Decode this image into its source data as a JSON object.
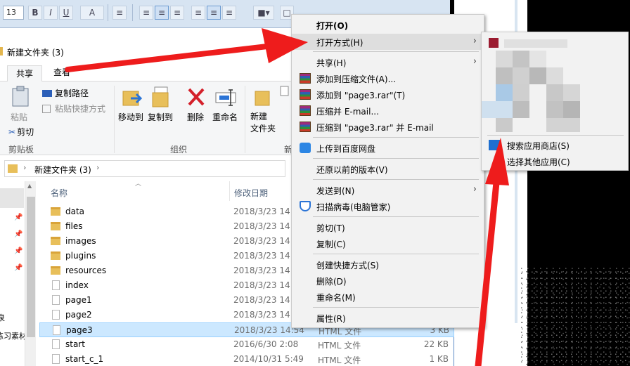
{
  "editor_toolbar": {
    "size_value": "13",
    "bold": "B",
    "italic": "I",
    "underline": "U",
    "font_color": "A"
  },
  "window": {
    "title": "新建文件夹 (3)"
  },
  "ribbon": {
    "tabs": [
      {
        "label": "共享"
      },
      {
        "label": "查看"
      }
    ],
    "clipboard": {
      "paste": "粘贴",
      "copy_path": "复制路径",
      "paste_shortcut": "粘贴快捷方式",
      "cut": "剪切",
      "group": "剪贴板"
    },
    "organize": {
      "move_to": "移动到",
      "copy_to": "复制到",
      "delete": "删除",
      "rename": "重命名",
      "group": "组织"
    },
    "new": {
      "new_folder": "新建\n文件夹",
      "group": "新"
    }
  },
  "address": {
    "path": "新建文件夹 (3)"
  },
  "nav": {
    "items": [
      "泉",
      "练习素材"
    ]
  },
  "columns": {
    "name": "名称",
    "date": "修改日期"
  },
  "files": [
    {
      "name": "data",
      "date": "2018/3/23 14:",
      "type": "",
      "size": "",
      "kind": "folder"
    },
    {
      "name": "files",
      "date": "2018/3/23 14:",
      "type": "",
      "size": "",
      "kind": "folder"
    },
    {
      "name": "images",
      "date": "2018/3/23 14:",
      "type": "",
      "size": "",
      "kind": "folder"
    },
    {
      "name": "plugins",
      "date": "2018/3/23 14:",
      "type": "",
      "size": "",
      "kind": "folder"
    },
    {
      "name": "resources",
      "date": "2018/3/23 14:",
      "type": "",
      "size": "",
      "kind": "folder"
    },
    {
      "name": "index",
      "date": "2018/3/23 14:",
      "type": "",
      "size": "",
      "kind": "file"
    },
    {
      "name": "page1",
      "date": "2018/3/23 14:",
      "type": "",
      "size": "",
      "kind": "file"
    },
    {
      "name": "page2",
      "date": "2018/3/23 14:",
      "type": "",
      "size": "",
      "kind": "file"
    },
    {
      "name": "page3",
      "date": "2018/3/23 14:54",
      "type": "HTML 文件",
      "size": "3 KB",
      "kind": "file"
    },
    {
      "name": "start",
      "date": "2016/6/30 2:08",
      "type": "HTML 文件",
      "size": "22 KB",
      "kind": "file"
    },
    {
      "name": "start_c_1",
      "date": "2014/10/31 5:49",
      "type": "HTML 文件",
      "size": "1 KB",
      "kind": "file"
    }
  ],
  "context_menu": {
    "open": "打开(O)",
    "open_with": "打开方式(H)",
    "share": "共享(H)",
    "add_archive": "添加到压缩文件(A)...",
    "add_rar": "添加到 \"page3.rar\"(T)",
    "compress_email": "压缩并 E-mail...",
    "compress_rar_email": "压缩到 \"page3.rar\" 并 E-mail",
    "upload_baidu": "上传到百度网盘",
    "restore": "还原以前的版本(V)",
    "send_to": "发送到(N)",
    "scan": "扫描病毒(电脑管家)",
    "cut": "剪切(T)",
    "copy": "复制(C)",
    "create_shortcut": "创建快捷方式(S)",
    "delete": "删除(D)",
    "rename": "重命名(M)",
    "properties": "属性(R)"
  },
  "submenu": {
    "search_store": "搜索应用商店(S)",
    "choose_other": "选择其他应用(C)"
  },
  "colors": {
    "arrow": "#ee1c1c",
    "selection": "#cce8ff",
    "menu_bg": "#f2f2f2"
  }
}
